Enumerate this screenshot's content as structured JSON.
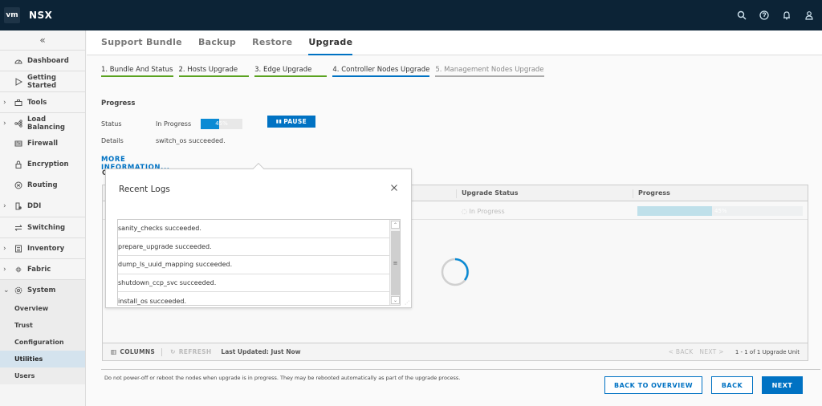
{
  "header": {
    "logo_text": "vm",
    "app_title": "NSX",
    "icons": [
      "search-icon",
      "help-icon",
      "bell-icon",
      "user-icon"
    ]
  },
  "sidebar": {
    "collapse_icon": "«",
    "items": [
      {
        "label": "Dashboard",
        "icon": "dashboard-icon",
        "expandable": false
      },
      {
        "label": "Getting Started",
        "icon": "play-icon",
        "expandable": false
      },
      {
        "label": "Tools",
        "icon": "toolbox-icon",
        "expandable": true
      },
      {
        "label": "Load Balancing",
        "icon": "load-balancer-icon",
        "expandable": true
      },
      {
        "label": "Firewall",
        "icon": "firewall-icon",
        "expandable": false
      },
      {
        "label": "Encryption",
        "icon": "lock-icon",
        "expandable": false
      },
      {
        "label": "Routing",
        "icon": "router-icon",
        "expandable": false
      },
      {
        "label": "DDI",
        "icon": "ddi-icon",
        "expandable": true
      },
      {
        "label": "Switching",
        "icon": "switch-arrows-icon",
        "expandable": false
      },
      {
        "label": "Inventory",
        "icon": "inventory-icon",
        "expandable": true
      },
      {
        "label": "Fabric",
        "icon": "fabric-icon",
        "expandable": true
      },
      {
        "label": "System",
        "icon": "gear-icon",
        "expandable": true,
        "expanded": true
      }
    ],
    "system_children": [
      "Overview",
      "Trust",
      "Configuration",
      "Utilities",
      "Users"
    ],
    "active_child": "Utilities"
  },
  "tabs": [
    {
      "label": "Support Bundle",
      "active": false
    },
    {
      "label": "Backup",
      "active": false
    },
    {
      "label": "Restore",
      "active": false
    },
    {
      "label": "Upgrade",
      "active": true
    }
  ],
  "steps": [
    {
      "label": "1. Bundle And Status",
      "state": "done"
    },
    {
      "label": "2. Hosts Upgrade",
      "state": "done"
    },
    {
      "label": "3. Edge Upgrade",
      "state": "done"
    },
    {
      "label": "4. Controller Nodes Upgrade",
      "state": "current"
    },
    {
      "label": "5. Management Nodes Upgrade",
      "state": "future"
    }
  ],
  "progress": {
    "title": "Progress",
    "status_label": "Status",
    "status_value": "In Progress",
    "percent": 45,
    "percent_text": "45%",
    "pause_label": "PAUSE",
    "details_label": "Details",
    "details_value": "switch_os succeeded.",
    "more_info_label": "MORE INFORMATION..."
  },
  "grid": {
    "columns": [
      "Upgrade Status",
      "Progress"
    ],
    "rows": [
      {
        "status": "In Progress",
        "percent": 45,
        "percent_text": "45%"
      }
    ],
    "footer": {
      "columns_label": "COLUMNS",
      "refresh_label": "REFRESH",
      "last_updated": "Last Updated: Just Now",
      "back_label": "< BACK",
      "next_label": "NEXT >",
      "count": "1 - 1 of 1 Upgrade Unit"
    }
  },
  "popover": {
    "title": "Recent Logs",
    "logs": [
      "sanity_checks succeeded.",
      "prepare_upgrade succeeded.",
      "dump_ls_uuid_mapping succeeded.",
      "shutdown_ccp_svc succeeded.",
      "install_os succeeded."
    ]
  },
  "footer": {
    "note": "Do not power-off or reboot the nodes when upgrade is in progress. They may be rebooted automatically as part of the upgrade process.",
    "back_to_overview": "BACK TO OVERVIEW",
    "back": "BACK",
    "next": "NEXT"
  },
  "colors": {
    "header_bg": "#0c2336",
    "accent": "#0072c3",
    "step_done": "#5aa220",
    "progress_fill": "#0a8ad4"
  }
}
